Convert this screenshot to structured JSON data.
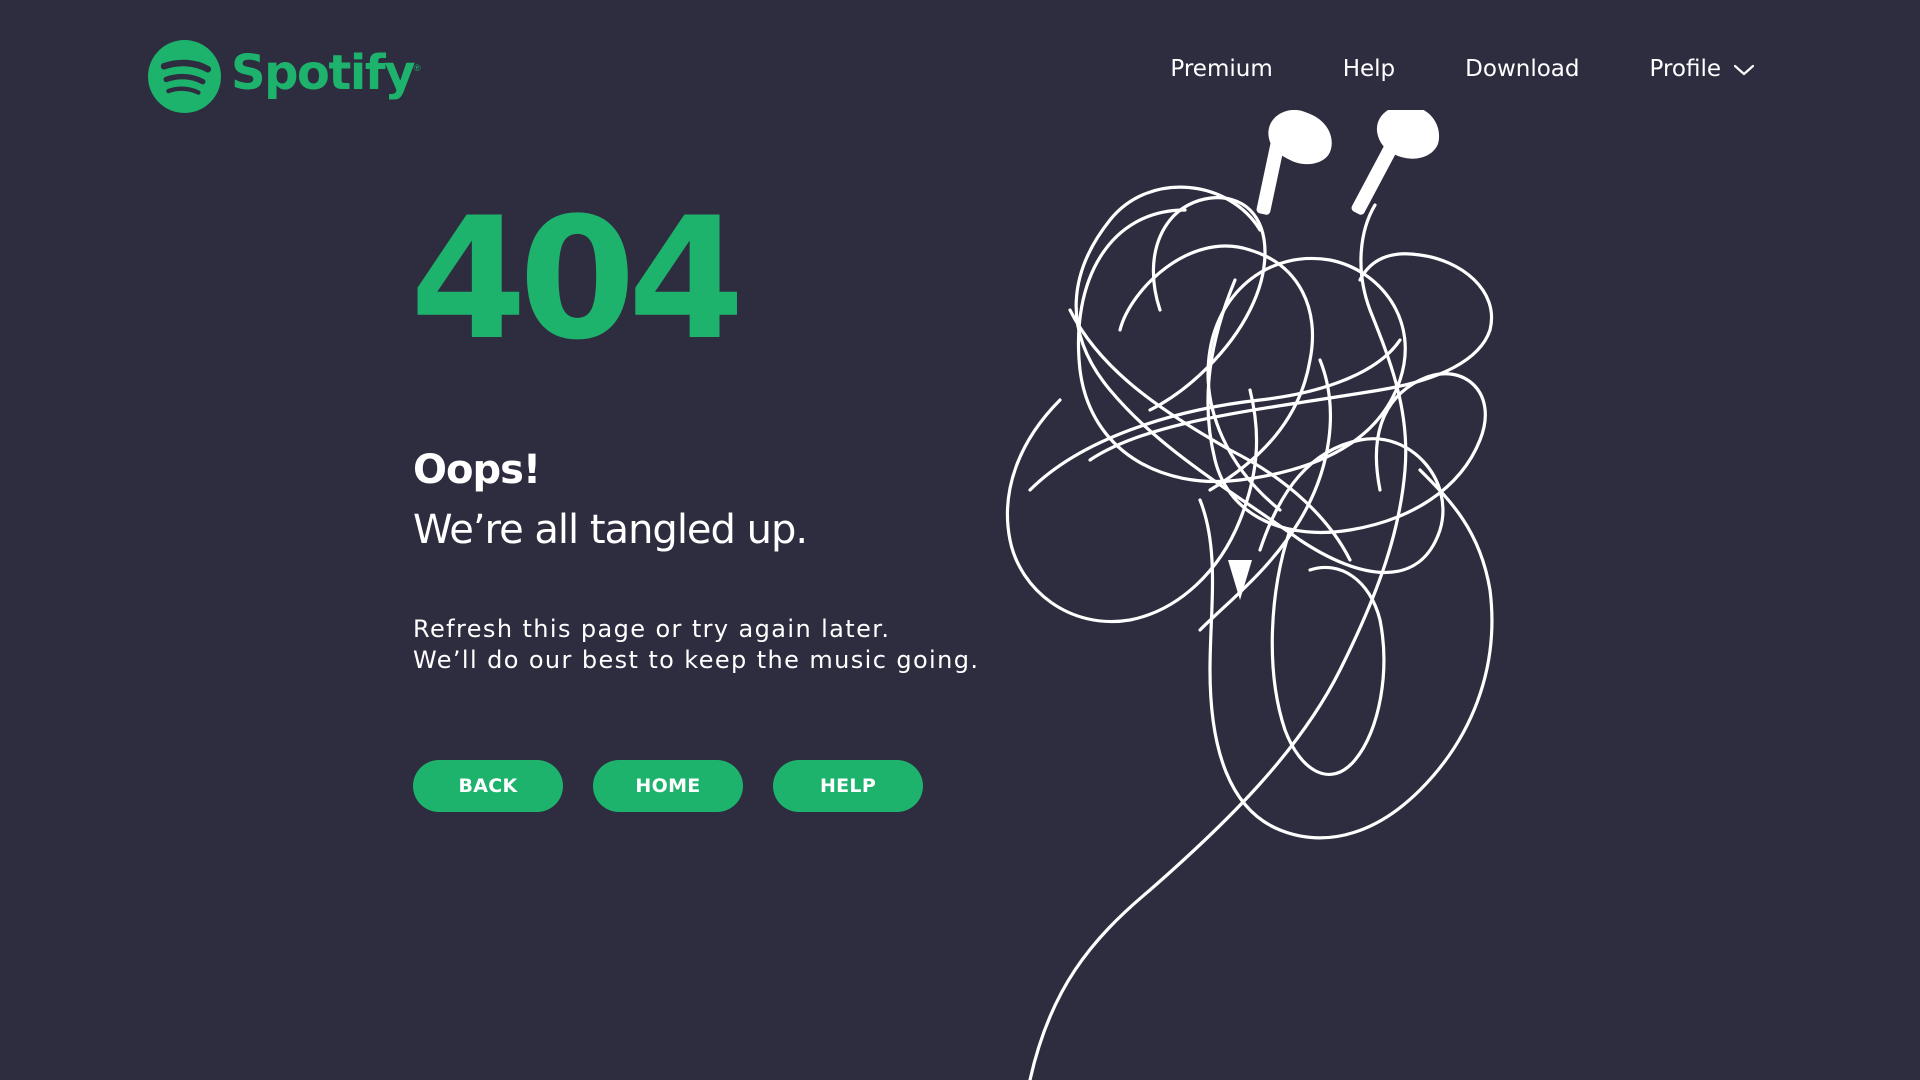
{
  "brand": {
    "name": "Spotify",
    "registered_mark": "®",
    "color": "#1db36d",
    "logo_icon": "spotify-logo-icon"
  },
  "nav": {
    "items": [
      {
        "label": "Premium"
      },
      {
        "label": "Help"
      },
      {
        "label": "Download"
      },
      {
        "label": "Profile",
        "icon": "chevron-down-icon"
      }
    ]
  },
  "main": {
    "error_code": "404",
    "heading": "Oops!",
    "subheading": "We’re all tangled up.",
    "description_lines": [
      "Refresh this page or try again later.",
      "We’ll do our best to keep the music going."
    ],
    "buttons": {
      "back": "BACK",
      "home": "HOME",
      "help": "HELP"
    }
  },
  "illustration": {
    "icon": "tangled-earphones-icon"
  },
  "colors": {
    "background": "#2e2d40",
    "accent": "#1db36d",
    "text": "#ffffff"
  }
}
